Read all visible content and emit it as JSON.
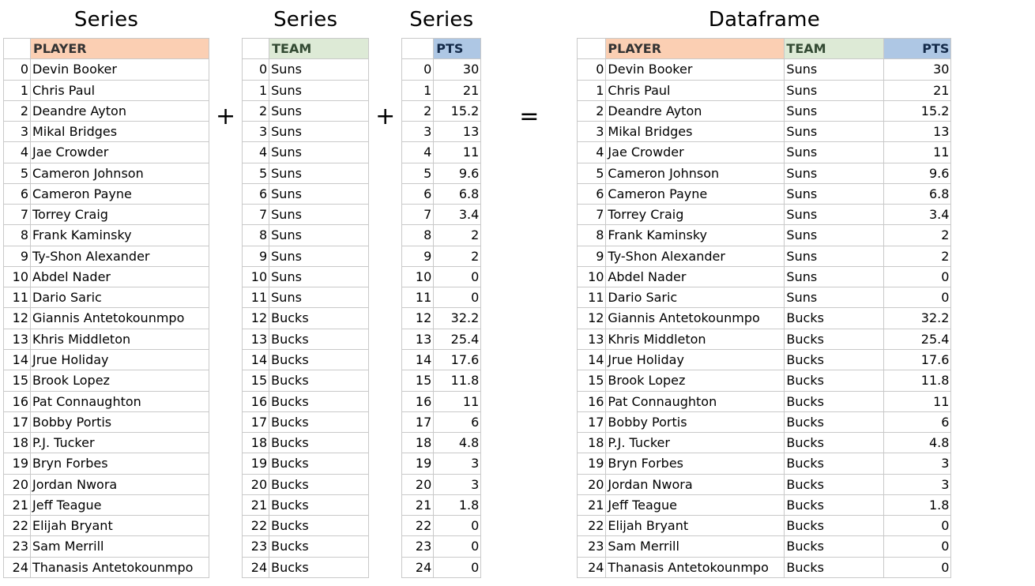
{
  "titles": {
    "series": "Series",
    "dataframe": "Dataframe"
  },
  "headers": {
    "player": "PLAYER",
    "team": "TEAM",
    "pts": "PTS"
  },
  "operators": {
    "plus": "+",
    "equals": "="
  },
  "index": [
    0,
    1,
    2,
    3,
    4,
    5,
    6,
    7,
    8,
    9,
    10,
    11,
    12,
    13,
    14,
    15,
    16,
    17,
    18,
    19,
    20,
    21,
    22,
    23,
    24
  ],
  "player": [
    "Devin Booker",
    "Chris Paul",
    "Deandre Ayton",
    "Mikal Bridges",
    "Jae Crowder",
    "Cameron Johnson",
    "Cameron Payne",
    "Torrey Craig",
    "Frank Kaminsky",
    "Ty-Shon Alexander",
    "Abdel Nader",
    "Dario Saric",
    "Giannis Antetokounmpo",
    "Khris Middleton",
    "Jrue Holiday",
    "Brook Lopez",
    "Pat Connaughton",
    "Bobby Portis",
    "P.J. Tucker",
    "Bryn Forbes",
    "Jordan Nwora",
    "Jeff Teague",
    "Elijah Bryant",
    "Sam Merrill",
    "Thanasis Antetokounmpo"
  ],
  "team": [
    "Suns",
    "Suns",
    "Suns",
    "Suns",
    "Suns",
    "Suns",
    "Suns",
    "Suns",
    "Suns",
    "Suns",
    "Suns",
    "Suns",
    "Bucks",
    "Bucks",
    "Bucks",
    "Bucks",
    "Bucks",
    "Bucks",
    "Bucks",
    "Bucks",
    "Bucks",
    "Bucks",
    "Bucks",
    "Bucks",
    "Bucks"
  ],
  "pts": [
    "30",
    "21",
    "15.2",
    "13",
    "11",
    "9.6",
    "6.8",
    "3.4",
    "2",
    "2",
    "0",
    "0",
    "32.2",
    "25.4",
    "17.6",
    "11.8",
    "11",
    "6",
    "4.8",
    "3",
    "3",
    "1.8",
    "0",
    "0",
    "0"
  ],
  "chart_data": {
    "type": "table",
    "title": "Series + Series + Series = Dataframe",
    "series": [
      {
        "name": "PLAYER",
        "values": [
          "Devin Booker",
          "Chris Paul",
          "Deandre Ayton",
          "Mikal Bridges",
          "Jae Crowder",
          "Cameron Johnson",
          "Cameron Payne",
          "Torrey Craig",
          "Frank Kaminsky",
          "Ty-Shon Alexander",
          "Abdel Nader",
          "Dario Saric",
          "Giannis Antetokounmpo",
          "Khris Middleton",
          "Jrue Holiday",
          "Brook Lopez",
          "Pat Connaughton",
          "Bobby Portis",
          "P.J. Tucker",
          "Bryn Forbes",
          "Jordan Nwora",
          "Jeff Teague",
          "Elijah Bryant",
          "Sam Merrill",
          "Thanasis Antetokounmpo"
        ]
      },
      {
        "name": "TEAM",
        "values": [
          "Suns",
          "Suns",
          "Suns",
          "Suns",
          "Suns",
          "Suns",
          "Suns",
          "Suns",
          "Suns",
          "Suns",
          "Suns",
          "Suns",
          "Bucks",
          "Bucks",
          "Bucks",
          "Bucks",
          "Bucks",
          "Bucks",
          "Bucks",
          "Bucks",
          "Bucks",
          "Bucks",
          "Bucks",
          "Bucks",
          "Bucks"
        ]
      },
      {
        "name": "PTS",
        "values": [
          30,
          21,
          15.2,
          13,
          11,
          9.6,
          6.8,
          3.4,
          2,
          2,
          0,
          0,
          32.2,
          25.4,
          17.6,
          11.8,
          11,
          6,
          4.8,
          3,
          3,
          1.8,
          0,
          0,
          0
        ]
      }
    ],
    "index": [
      0,
      1,
      2,
      3,
      4,
      5,
      6,
      7,
      8,
      9,
      10,
      11,
      12,
      13,
      14,
      15,
      16,
      17,
      18,
      19,
      20,
      21,
      22,
      23,
      24
    ]
  }
}
